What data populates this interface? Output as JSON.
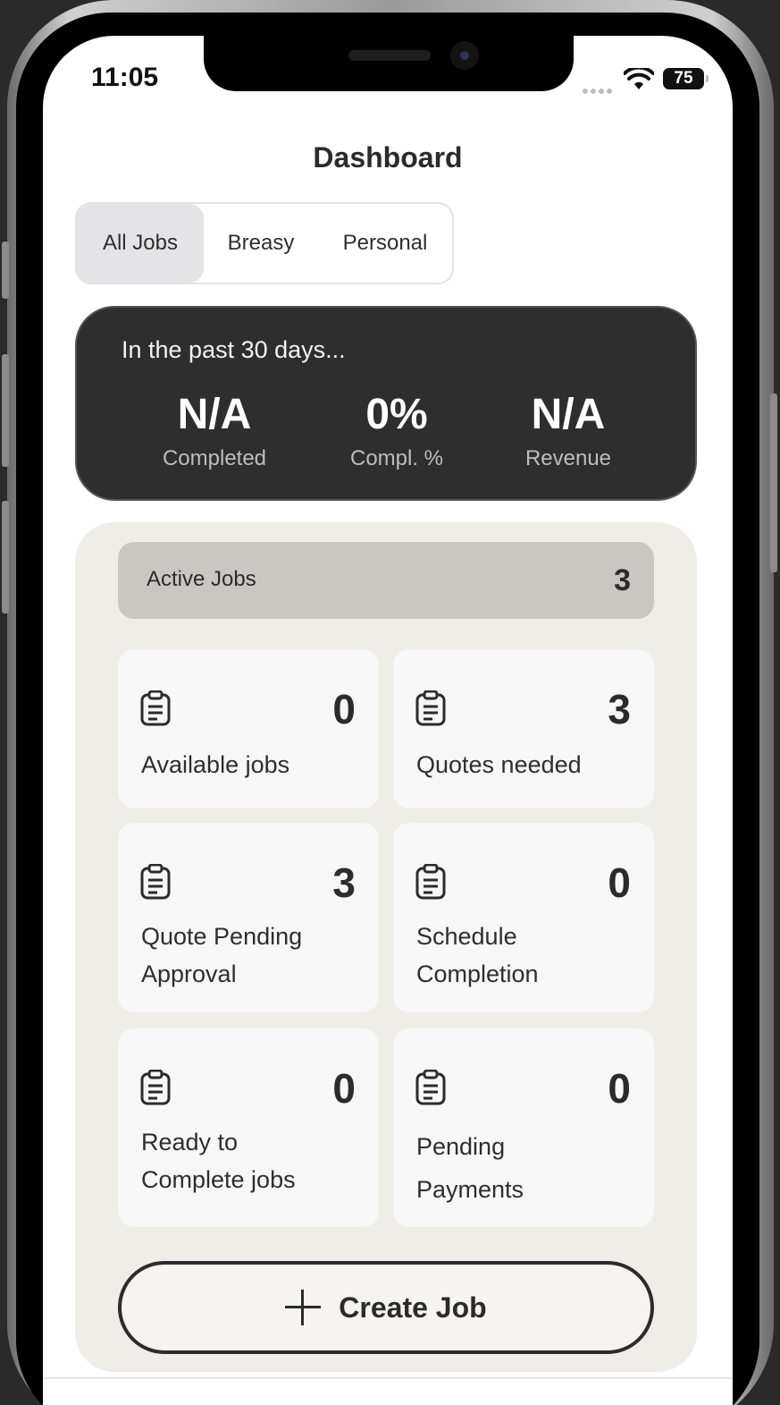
{
  "status": {
    "time": "11:05",
    "battery": "75"
  },
  "header": {
    "title": "Dashboard"
  },
  "filter_tabs": [
    {
      "label": "All Jobs",
      "active": true
    },
    {
      "label": "Breasy",
      "active": false
    },
    {
      "label": "Personal",
      "active": false
    }
  ],
  "summary": {
    "heading": "In the past 30 days...",
    "stats": [
      {
        "value": "N/A",
        "label": "Completed"
      },
      {
        "value": "0%",
        "label": "Compl. %"
      },
      {
        "value": "N/A",
        "label": "Revenue"
      }
    ]
  },
  "active_jobs": {
    "label": "Active Jobs",
    "count": "3"
  },
  "cards": [
    {
      "label": "Available jobs",
      "count": "0",
      "icon": "clipboard-icon"
    },
    {
      "label": "Quotes needed",
      "count": "3",
      "icon": "clipboard-icon"
    },
    {
      "label": "Quote Pending Approval",
      "count": "3",
      "icon": "clipboard-icon"
    },
    {
      "label": "Schedule Completion",
      "count": "0",
      "icon": "clipboard-icon"
    },
    {
      "label": "Ready to Complete jobs",
      "count": "0",
      "icon": "clipboard-icon"
    },
    {
      "label": "Pending Payments",
      "count": "0",
      "icon": "clipboard-icon"
    }
  ],
  "create_button": {
    "label": "Create Job",
    "icon": "plus-icon"
  },
  "colors": {
    "dark_card": "#2e2e2e",
    "panel_bg": "#efede8",
    "active_bar": "#cac7c2",
    "card_bg": "#f7f7f7"
  }
}
